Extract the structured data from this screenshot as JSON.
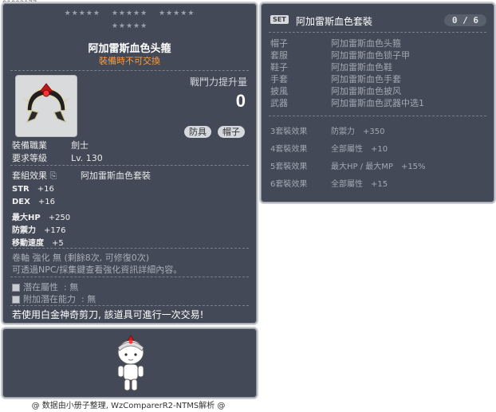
{
  "item_id": "01003177",
  "stars": [
    "★★★★★",
    "★★★★★",
    "★★★★★",
    "★★★★★"
  ],
  "item": {
    "name": "阿加雷斯血色头箍",
    "trade_note": "裝備時不可交換",
    "combat_power_label": "戰鬥力提升量",
    "combat_power_value": "0",
    "tags": [
      "防具",
      "帽子"
    ],
    "job_label": "裝備職業",
    "job_value": "劍士",
    "level_label": "要求等級",
    "level_value": "Lv. 130",
    "set_label": "套組效果",
    "set_value": "阿加雷斯血色套裝",
    "stats": [
      {
        "name": "STR",
        "value": "+16"
      },
      {
        "name": "DEX",
        "value": "+16"
      },
      {
        "name": "最大HP",
        "value": "+250"
      },
      {
        "name": "防禦力",
        "value": "+176"
      },
      {
        "name": "移動速度",
        "value": "+5"
      }
    ],
    "upgrade_line": "卷軸 強化 無 (剩餘8次, 可修復0次)",
    "upgrade_hint": "可透過NPC/採集鍵查看強化資訊詳細內容。",
    "potential_label": "潛在屬性",
    "potential_value": ": 無",
    "bonus_potential_label": "附加潛在能力",
    "bonus_potential_value": ": 無",
    "trade_info": "若使用白金神奇剪刀, 該道具可進行一次交易!"
  },
  "set": {
    "badge": "SET",
    "name": "阿加雷斯血色套裝",
    "count": "0 / 6",
    "pieces": [
      {
        "slot": "帽子",
        "name": "阿加雷斯血色头箍"
      },
      {
        "slot": "套服",
        "name": "阿加雷斯血色锁子甲"
      },
      {
        "slot": "鞋子",
        "name": "阿加雷斯血色鞋"
      },
      {
        "slot": "手套",
        "name": "阿加雷斯血色手套"
      },
      {
        "slot": "披風",
        "name": "阿加雷斯血色披风"
      },
      {
        "slot": "武器",
        "name": "阿加雷斯血色武器中选1"
      }
    ],
    "effects": [
      {
        "tier": "3套裝效果",
        "text": "防禦力",
        "value": "+350"
      },
      {
        "tier": "4套裝效果",
        "text": "全部屬性",
        "value": "+10"
      },
      {
        "tier": "5套裝效果",
        "text": "最大HP / 最大MP",
        "value": "+15%"
      },
      {
        "tier": "6套裝效果",
        "text": "全部屬性",
        "value": "+15"
      }
    ]
  },
  "footer": "@ 数据由小册子整理, WzComparerR2-NTMS解析 @"
}
